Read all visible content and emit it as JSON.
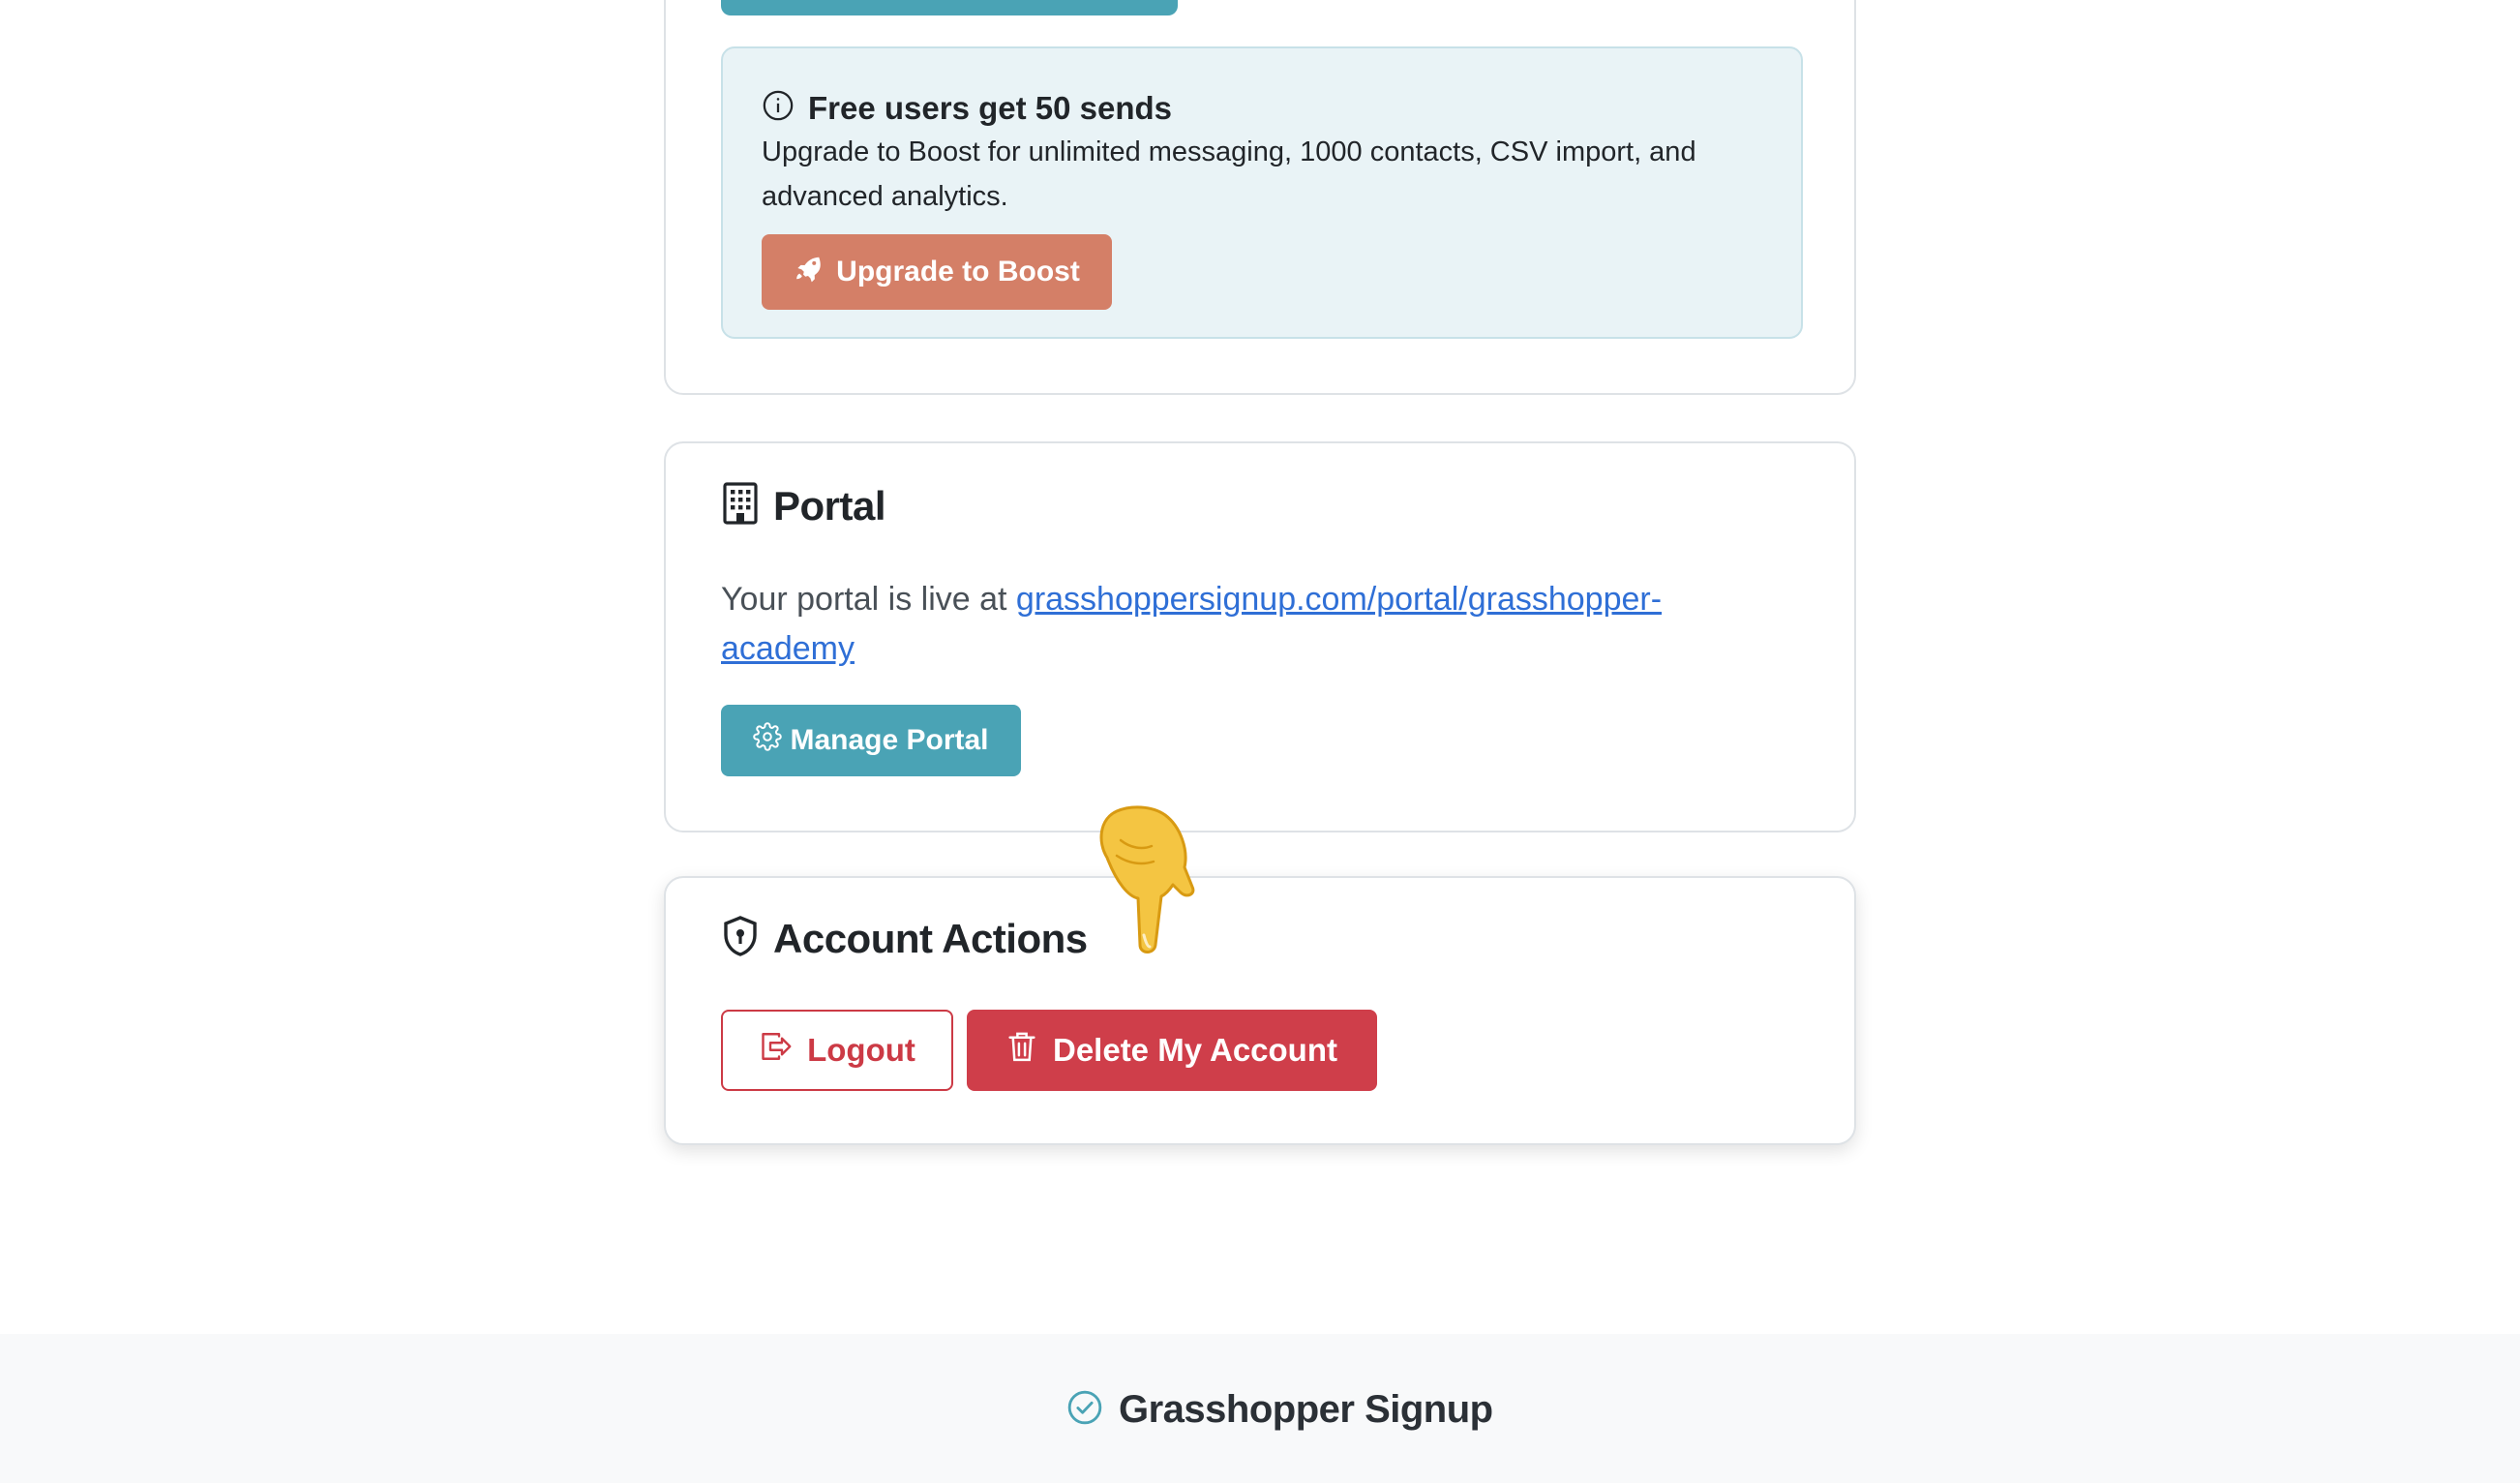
{
  "plan_card": {
    "notice": {
      "icon": "info-icon",
      "title": "Free users get 50 sends",
      "text": "Upgrade to Boost for unlimited messaging, 1000 contacts, CSV import, and advanced analytics.",
      "upgrade_button": {
        "icon": "rocket-icon",
        "label": "Upgrade to Boost"
      }
    }
  },
  "portal_card": {
    "icon": "building-icon",
    "title": "Portal",
    "text_prefix": "Your portal is live at ",
    "link_text": "grasshoppersignup.com/portal/grasshopper-academy",
    "manage_button": {
      "icon": "gear-icon",
      "label": "Manage Portal"
    }
  },
  "account_actions": {
    "icon": "shield-icon",
    "title": "Account Actions",
    "logout_button": {
      "icon": "logout-icon",
      "label": "Logout"
    },
    "delete_button": {
      "icon": "trash-icon",
      "label": "Delete My Account"
    }
  },
  "footer": {
    "icon": "check-circle-icon",
    "brand": "Grasshopper Signup"
  },
  "colors": {
    "accent_teal": "#4aa3b5",
    "boost_orange": "#d47f67",
    "danger_red": "#cf3e4a",
    "link_blue": "#2f6fd6",
    "notice_bg": "#e9f3f6"
  }
}
